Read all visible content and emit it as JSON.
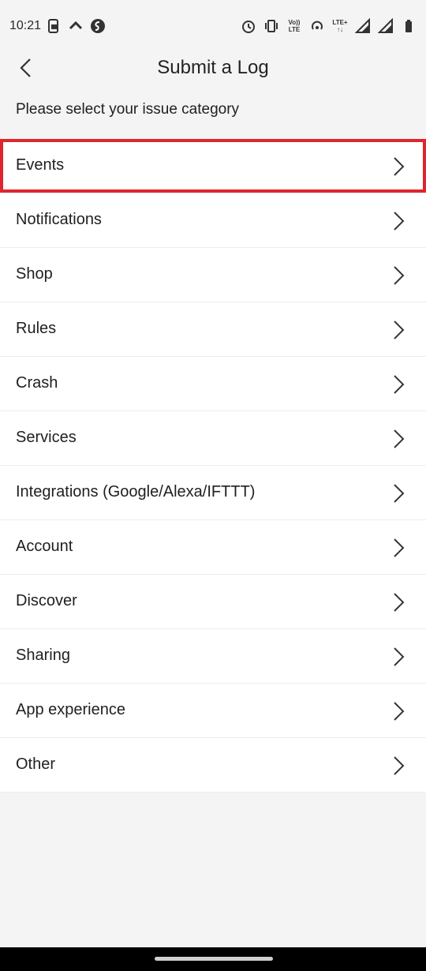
{
  "status_bar": {
    "time": "10:21",
    "volte_label": "Vo))\nLTE",
    "lte_label": "LTE+"
  },
  "header": {
    "title": "Submit a Log"
  },
  "subtitle": "Please select your issue category",
  "categories": [
    {
      "label": "Events",
      "highlighted": true
    },
    {
      "label": "Notifications"
    },
    {
      "label": "Shop"
    },
    {
      "label": "Rules"
    },
    {
      "label": "Crash"
    },
    {
      "label": "Services"
    },
    {
      "label": "Integrations (Google/Alexa/IFTTT)"
    },
    {
      "label": "Account"
    },
    {
      "label": "Discover"
    },
    {
      "label": "Sharing"
    },
    {
      "label": "App experience"
    },
    {
      "label": "Other"
    }
  ],
  "colors": {
    "background": "#f4f4f4",
    "row_background": "#ffffff",
    "highlight_border": "#e0252d"
  },
  "icons": {
    "back": "chevron-left-icon",
    "row": "chevron-right-icon"
  }
}
